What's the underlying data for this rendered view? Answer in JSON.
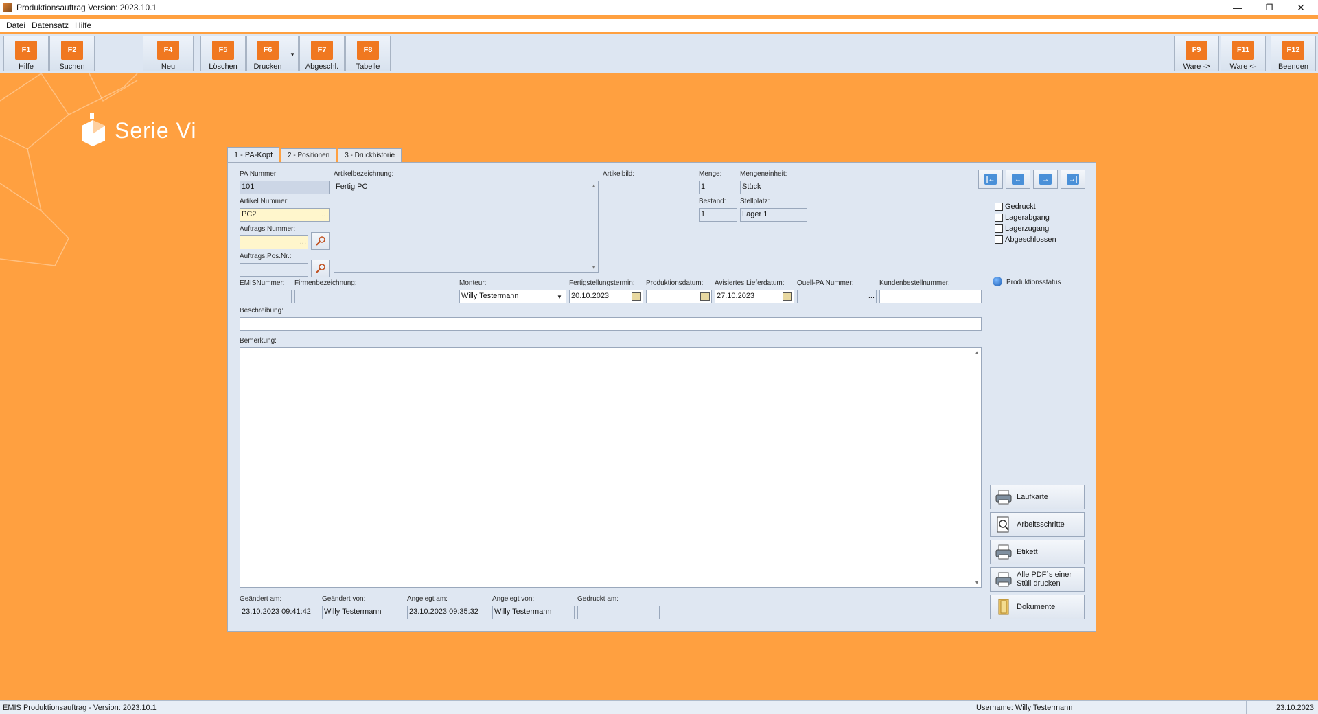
{
  "window": {
    "title": "Produktionsauftrag Version: 2023.10.1",
    "minimize": "—",
    "restore": "❐",
    "close": "✕"
  },
  "menu": [
    "Datei",
    "Datensatz",
    "Hilfe"
  ],
  "toolbar": {
    "buttons": [
      {
        "key": "F1",
        "label": "Hilfe"
      },
      {
        "key": "F2",
        "label": "Suchen"
      },
      {
        "key": "F4",
        "label": "Neu"
      },
      {
        "key": "F5",
        "label": "Löschen"
      },
      {
        "key": "F6",
        "label": "Drucken"
      },
      {
        "key": "F7",
        "label": "Abgeschl."
      },
      {
        "key": "F8",
        "label": "Tabelle"
      },
      {
        "key": "F9",
        "label": "Ware ->"
      },
      {
        "key": "F11",
        "label": "Ware <-"
      },
      {
        "key": "F12",
        "label": "Beenden"
      }
    ]
  },
  "logo": {
    "text": "Serie Vi"
  },
  "tabs": [
    "1 - PA-Kopf",
    "2 - Positionen",
    "3 - Druckhistorie"
  ],
  "form": {
    "pa_nummer_label": "PA Nummer:",
    "pa_nummer": "101",
    "artikel_nummer_label": "Artikel Nummer:",
    "artikel_nummer": "PC2",
    "auftrags_nummer_label": "Auftrags Nummer:",
    "auftrags_nummer": "",
    "auftrags_pos_label": "Auftrags.Pos.Nr.:",
    "auftrags_pos": "",
    "artikelbezeichnung_label": "Artikelbezeichnung:",
    "artikelbezeichnung": "Fertig PC",
    "artikelbild_label": "Artikelbild:",
    "menge_label": "Menge:",
    "menge": "1",
    "mengeneinheit_label": "Mengeneinheit:",
    "mengeneinheit": "Stück",
    "bestand_label": "Bestand:",
    "bestand": "1",
    "stellplatz_label": "Stellplatz:",
    "stellplatz": "Lager 1",
    "emisnummer_label": "EMISNummer:",
    "emisnummer": "",
    "firmenbezeichnung_label": "Firmenbezeichnung:",
    "firmenbezeichnung": "",
    "monteur_label": "Monteur:",
    "monteur": "Willy Testermann",
    "fertigstellungstermin_label": "Fertigstellungstermin:",
    "fertigstellungstermin": "20.10.2023",
    "produktionsdatum_label": "Produktionsdatum:",
    "produktionsdatum": "",
    "avisiertes_lieferdatum_label": "Avisiertes Lieferdatum:",
    "avisiertes_lieferdatum": "27.10.2023",
    "quell_pa_label": "Quell-PA Nummer:",
    "quell_pa": "",
    "kundenbestellnummer_label": "Kundenbestellnummer:",
    "kundenbestellnummer": "",
    "beschreibung_label": "Beschreibung:",
    "beschreibung": "",
    "bemerkung_label": "Bemerkung:",
    "bemerkung": "",
    "geaendert_am_label": "Geändert am:",
    "geaendert_am": "23.10.2023 09:41:42",
    "geaendert_von_label": "Geändert von:",
    "geaendert_von": "Willy Testermann",
    "angelegt_am_label": "Angelegt am:",
    "angelegt_am": "23.10.2023 09:35:32",
    "angelegt_von_label": "Angelegt von:",
    "angelegt_von": "Willy Testermann",
    "gedruckt_am_label": "Gedruckt am:",
    "gedruckt_am": ""
  },
  "checkboxes": [
    "Gedruckt",
    "Lagerabgang",
    "Lagerzugang",
    "Abgeschlossen"
  ],
  "produktionsstatus_label": "Produktionsstatus",
  "side_buttons": {
    "laufkarte": "Laufkarte",
    "arbeitsschritte": "Arbeitsschritte",
    "etikett": "Etikett",
    "alle_pdf_line1": "Alle PDF´s einer",
    "alle_pdf_line2": "Stüli drucken",
    "dokumente": "Dokumente"
  },
  "statusbar": {
    "left": "EMIS Produktionsauftrag - Version: 2023.10.1",
    "user": "Username: Willy Testermann",
    "date": "23.10.2023"
  },
  "icons": {
    "nav_first": "first-record-icon",
    "nav_prev": "prev-record-icon",
    "nav_next": "next-record-icon",
    "nav_last": "last-record-icon"
  },
  "colors": {
    "background": "#ffa040",
    "key_orange": "#f07820",
    "panel": "#dfe7f2"
  }
}
